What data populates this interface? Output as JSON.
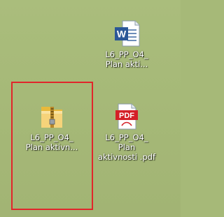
{
  "desktop": {
    "icons": [
      {
        "label": "L6_PP_O4_ Plan akti...",
        "type": "word-document-icon"
      },
      {
        "label": "L6_PP_O4_ Plan aktivn...",
        "type": "zip-folder-icon"
      },
      {
        "label": "L6_PP_O4_ Plan aktivnosti .pdf",
        "type": "pdf-document-icon"
      }
    ],
    "pdf_badge": "PDF",
    "word_badge": "W"
  },
  "colors": {
    "desktop_background": "#a6b978",
    "selection_border": "#e1262b",
    "pdf_red": "#d42027",
    "word_blue": "#2b5797",
    "zip_yellow": "#f2c94c"
  }
}
